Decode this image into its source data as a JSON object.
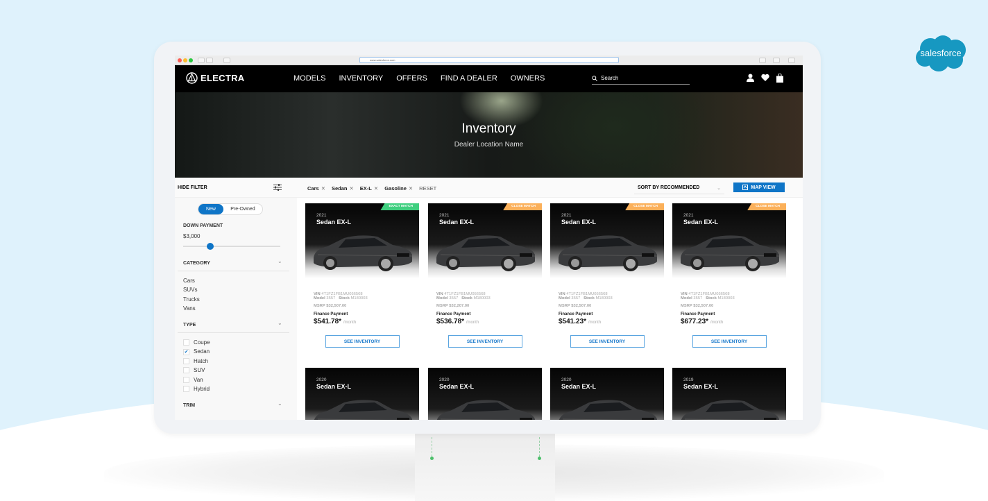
{
  "brand_logo": "salesforce",
  "browser": {
    "url": "www.salesforce.com"
  },
  "nav": {
    "logo_text": "ELECTRA",
    "menu": [
      "MODELS",
      "INVENTORY",
      "OFFERS",
      "FIND A DEALER",
      "OWNERS"
    ],
    "search_placeholder": "Search",
    "icons": [
      "user-icon",
      "heart-icon",
      "shopping-bag-icon"
    ]
  },
  "hero": {
    "title": "Inventory",
    "subtitle": "Dealer Location Name"
  },
  "filter_bar": {
    "hide_filter": "HIDE FILTER",
    "chips": [
      "Cars",
      "Sedan",
      "EX-L",
      "Gasoline"
    ],
    "reset": "RESET",
    "sort": "SORT BY RECOMMENDED",
    "map_view": "MAP VIEW"
  },
  "sidebar": {
    "condition": {
      "options": [
        "New",
        "Pre-Owned"
      ],
      "selected": "New"
    },
    "down_payment": {
      "label": "DOWN PAYMENT",
      "value": "$3,000",
      "slider_fraction": 0.28
    },
    "category": {
      "label": "CATEGORY",
      "items": [
        "Cars",
        "SUVs",
        "Trucks",
        "Vans"
      ]
    },
    "type": {
      "label": "TYPE",
      "items": [
        {
          "label": "Coupe",
          "checked": false
        },
        {
          "label": "Sedan",
          "checked": true
        },
        {
          "label": "Hatch",
          "checked": false
        },
        {
          "label": "SUV",
          "checked": false
        },
        {
          "label": "Van",
          "checked": false
        },
        {
          "label": "Hybrid",
          "checked": false
        }
      ]
    },
    "trim": {
      "label": "TRIM"
    }
  },
  "colors": {
    "accent": "#0f75c7",
    "exact_match": "#3fcf7f",
    "close_match": "#fbb05a"
  },
  "card_labels": {
    "vin": "VIN",
    "model": "Model",
    "stock": "Stock",
    "finance": "Finance Payment",
    "per_month": "/month",
    "button": "SEE INVENTORY"
  },
  "cards": [
    {
      "year": "2021",
      "model": "Sedan EX-L",
      "badge": "EXACT MATCH",
      "badge_type": "exact",
      "vin": "4T1FZ1FB1MU056568",
      "model_no": "3557",
      "stock": "M180003",
      "msrp": "MSRP $32,507.00",
      "payment": "$541.78*"
    },
    {
      "year": "2021",
      "model": "Sedan EX-L",
      "badge": "CLOSE MATCH",
      "badge_type": "close",
      "vin": "4T1FZ1FB1MU056568",
      "model_no": "3557",
      "stock": "M180003",
      "msrp": "MSRP $32,207.00",
      "payment": "$536.78*"
    },
    {
      "year": "2021",
      "model": "Sedan EX-L",
      "badge": "CLOSE MATCH",
      "badge_type": "close",
      "vin": "4T1FZ1FB1MU056568",
      "model_no": "3557",
      "stock": "M180003",
      "msrp": "MSRP $32,507.00",
      "payment": "$541.23*"
    },
    {
      "year": "2021",
      "model": "Sedan EX-L",
      "badge": "CLOSE MATCH",
      "badge_type": "close",
      "vin": "4T1FZ1FB1MU056568",
      "model_no": "3557",
      "stock": "M180003",
      "msrp": "MSRP $32,507.00",
      "payment": "$677.23*"
    },
    {
      "year": "2020",
      "model": "Sedan EX-L"
    },
    {
      "year": "2020",
      "model": "Sedan EX-L"
    },
    {
      "year": "2020",
      "model": "Sedan EX-L"
    },
    {
      "year": "2019",
      "model": "Sedan EX-L"
    }
  ]
}
